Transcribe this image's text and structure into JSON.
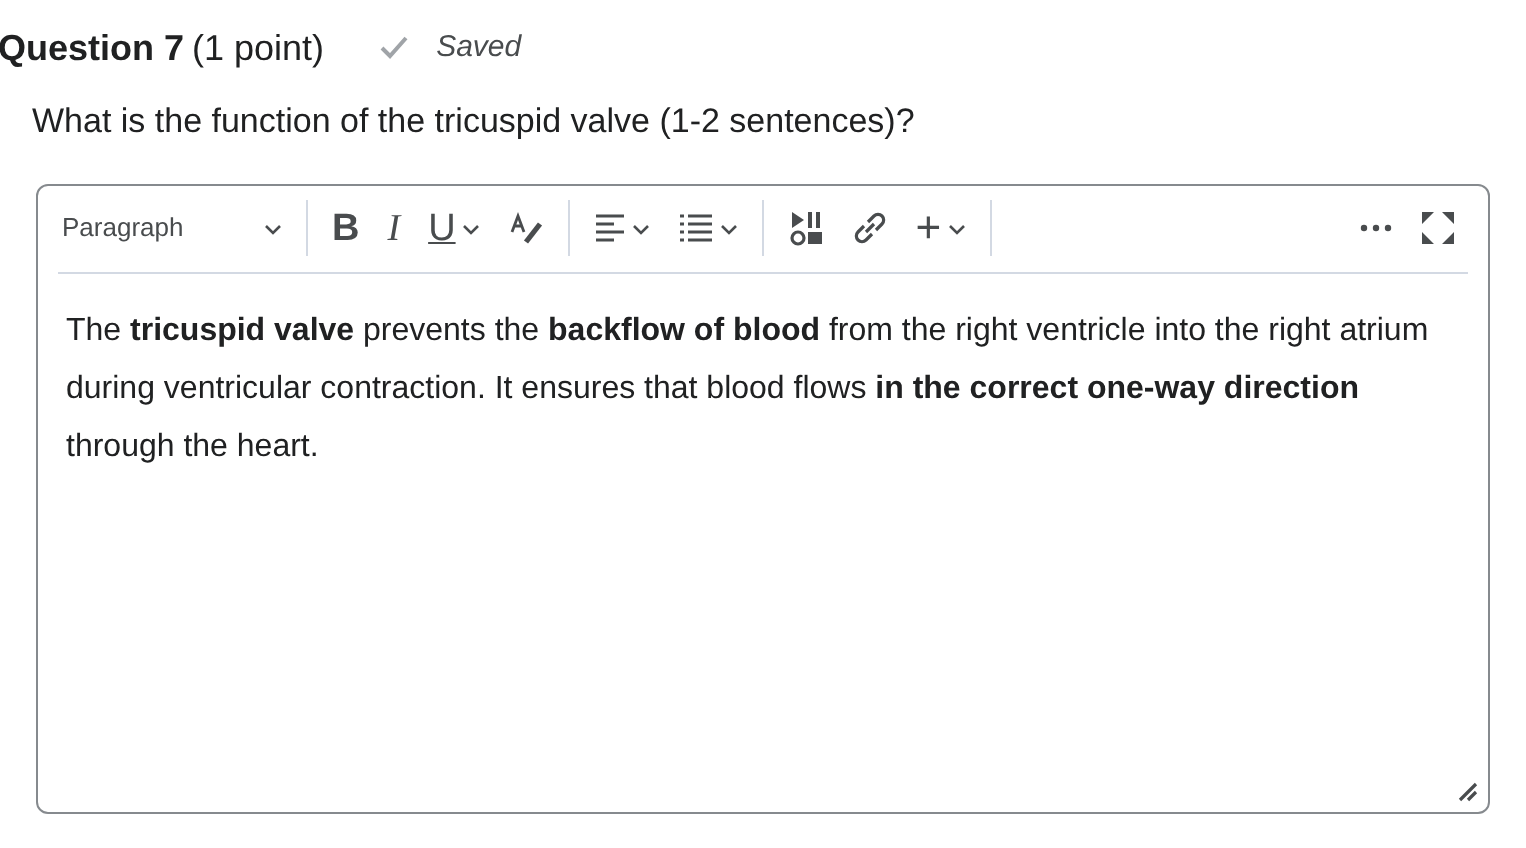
{
  "question": {
    "title": "Question 7",
    "points": "(1 point)",
    "status": "Saved",
    "saved": true
  },
  "prompt": "What is the function of the tricuspid valve (1-2 sentences)?",
  "editor": {
    "block_format": "Paragraph",
    "toolbar": [
      {
        "kind": "bold",
        "label": "B",
        "dropdown": false
      },
      {
        "kind": "italic",
        "label": "I",
        "dropdown": false
      },
      {
        "kind": "underline",
        "label": "U",
        "dropdown": true
      },
      {
        "kind": "color",
        "dropdown": false
      },
      {
        "kind": "separator"
      },
      {
        "kind": "align",
        "dropdown": true
      },
      {
        "kind": "list",
        "dropdown": true
      },
      {
        "kind": "separator"
      },
      {
        "kind": "media",
        "dropdown": false
      },
      {
        "kind": "link",
        "dropdown": false
      },
      {
        "kind": "insert",
        "label": "+",
        "dropdown": true
      },
      {
        "kind": "separator"
      }
    ],
    "answer": "The **tricuspid valve** prevents the **backflow of blood** from the right ventricle into the right atrium during ventricular contraction. It ensures that blood flows **in the correct one-way direction** through the heart."
  }
}
